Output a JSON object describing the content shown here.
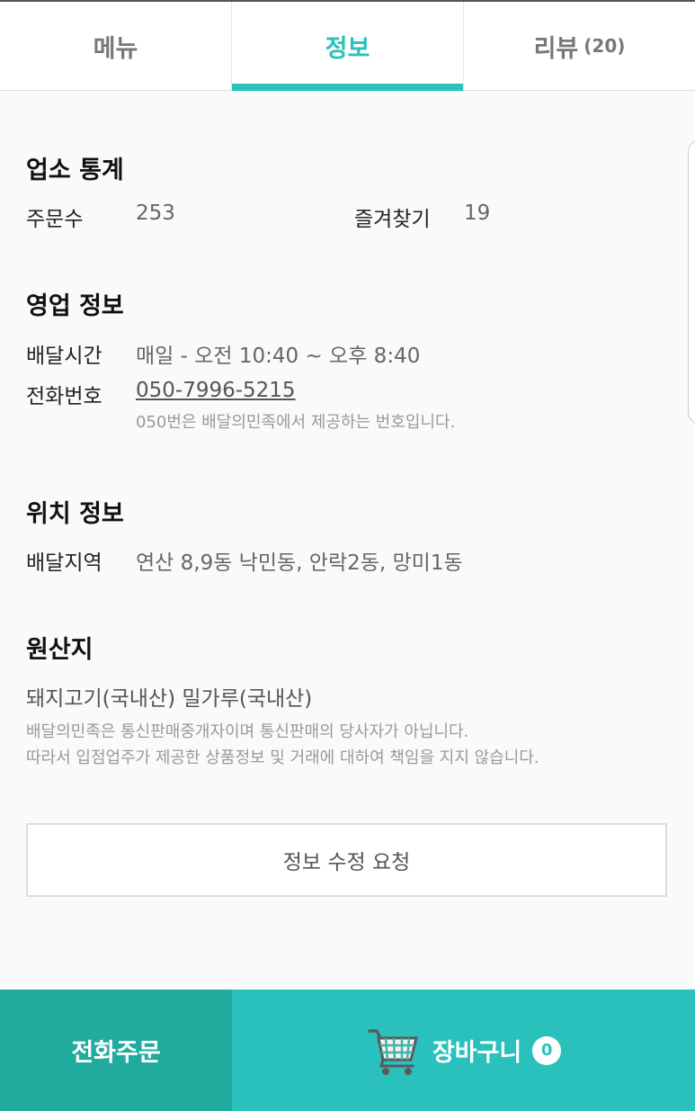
{
  "tabs": [
    {
      "label": "메뉴",
      "active": false
    },
    {
      "label": "정보",
      "active": true
    },
    {
      "label": "리뷰",
      "count": "(20)",
      "active": false
    }
  ],
  "stats": {
    "title": "업소 통계",
    "orders_label": "주문수",
    "orders_value": "253",
    "favorites_label": "즐겨찾기",
    "favorites_value": "19"
  },
  "business": {
    "title": "영업 정보",
    "hours_label": "배달시간",
    "hours_value": "매일 - 오전 10:40 ~ 오후 8:40",
    "phone_label": "전화번호",
    "phone_value": "050-7996-5215",
    "phone_note": "050번은 배달의민족에서 제공하는 번호입니다."
  },
  "location": {
    "title": "위치 정보",
    "area_label": "배달지역",
    "area_value": "연산 8,9동 낙민동, 안락2동, 망미1동"
  },
  "origin": {
    "title": "원산지",
    "text": "돼지고기(국내산) 밀가루(국내산)",
    "disclaimer_line1": "배달의민족은 통신판매중개자이며 통신판매의 당사자가 아닙니다.",
    "disclaimer_line2": "따라서 입점업주가 제공한 상품정보 및 거래에 대하여 책임을 지지 않습니다."
  },
  "edit_button": "정보 수정 요청",
  "bottom_bar": {
    "call_label": "전화주문",
    "cart_label": "장바구니",
    "cart_count": "0"
  },
  "colors": {
    "accent": "#2ac1bc",
    "call_bg": "#21ab9f"
  }
}
